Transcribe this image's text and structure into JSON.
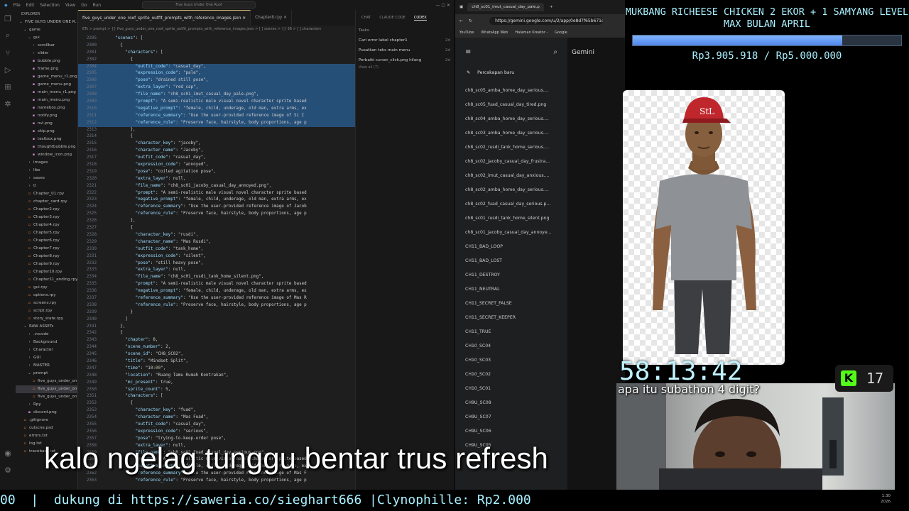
{
  "vscode": {
    "title_menu": [
      "File",
      "Edit",
      "Selection",
      "View",
      "Go",
      "Run"
    ],
    "search": "Five Guys Under One Roof",
    "explorer_title": "EXPLORER",
    "tree": [
      {
        "label": "FIVE GUYS UNDER ONE R...",
        "icon": "chevron-down",
        "indent": 0
      },
      {
        "label": "game",
        "icon": "chevron-down",
        "indent": 1
      },
      {
        "label": "gui",
        "icon": "chevron-down",
        "indent": 2
      },
      {
        "label": "scrollbar",
        "icon": "chevron-right",
        "indent": 3
      },
      {
        "label": "slider",
        "icon": "chevron-right",
        "indent": 3
      },
      {
        "label": "bubble.png",
        "icon": "image",
        "indent": 3
      },
      {
        "label": "frame.png",
        "icon": "image",
        "indent": 3
      },
      {
        "label": "game_menu_r1.png",
        "icon": "image",
        "indent": 3
      },
      {
        "label": "game_menu.png",
        "icon": "image",
        "indent": 3
      },
      {
        "label": "main_menu_r1.png",
        "icon": "image",
        "indent": 3
      },
      {
        "label": "main_menu.png",
        "icon": "image",
        "indent": 3
      },
      {
        "label": "namebox.png",
        "icon": "image",
        "indent": 3
      },
      {
        "label": "notify.png",
        "icon": "image",
        "indent": 3
      },
      {
        "label": "nvl.png",
        "icon": "image",
        "indent": 3
      },
      {
        "label": "skip.png",
        "icon": "image",
        "indent": 3
      },
      {
        "label": "textbox.png",
        "icon": "image",
        "indent": 3
      },
      {
        "label": "thoughtbubble.png",
        "icon": "image",
        "indent": 3
      },
      {
        "label": "window_icon.png",
        "icon": "image",
        "indent": 3
      },
      {
        "label": "images",
        "icon": "chevron-right",
        "indent": 2
      },
      {
        "label": "libs",
        "icon": "chevron-right",
        "indent": 2
      },
      {
        "label": "saves",
        "icon": "chevron-right",
        "indent": 2
      },
      {
        "label": "tl",
        "icon": "chevron-right",
        "indent": 2
      },
      {
        "label": "Chapter_01.rpy",
        "icon": "file",
        "indent": 2
      },
      {
        "label": "chapter_card.rpy",
        "icon": "file",
        "indent": 2
      },
      {
        "label": "Chapter2.rpy",
        "icon": "file",
        "indent": 2
      },
      {
        "label": "Chapter3.rpy",
        "icon": "file",
        "indent": 2
      },
      {
        "label": "Chapter4.rpy",
        "icon": "file",
        "indent": 2
      },
      {
        "label": "Chapter5.rpy",
        "icon": "file",
        "indent": 2
      },
      {
        "label": "Chapter6.rpy",
        "icon": "file",
        "indent": 2
      },
      {
        "label": "Chapter7.rpy",
        "icon": "file",
        "indent": 2
      },
      {
        "label": "Chapter8.rpy",
        "icon": "file",
        "indent": 2
      },
      {
        "label": "Chapter9.rpy",
        "icon": "file",
        "indent": 2
      },
      {
        "label": "Chapter10.rpy",
        "icon": "file",
        "indent": 2
      },
      {
        "label": "Chapter11_ending.rpy",
        "icon": "file",
        "indent": 2
      },
      {
        "label": "gui.rpy",
        "icon": "file",
        "indent": 2
      },
      {
        "label": "options.rpy",
        "icon": "file",
        "indent": 2
      },
      {
        "label": "screens.rpy",
        "icon": "file",
        "indent": 2
      },
      {
        "label": "script.rpy",
        "icon": "file",
        "indent": 2
      },
      {
        "label": "story_state.rpy",
        "icon": "file",
        "indent": 2
      },
      {
        "label": "RAW ASSETs",
        "icon": "chevron-down",
        "indent": 1
      },
      {
        "label": ".vscode",
        "icon": "chevron-right",
        "indent": 2
      },
      {
        "label": "Background",
        "icon": "chevron-right",
        "indent": 2
      },
      {
        "label": "Character",
        "icon": "chevron-right",
        "indent": 2
      },
      {
        "label": "GUI",
        "icon": "chevron-right",
        "indent": 2
      },
      {
        "label": "MASTER",
        "icon": "chevron-right",
        "indent": 2
      },
      {
        "label": "prompt",
        "icon": "chevron-down",
        "indent": 2
      },
      {
        "label": "five_guys_under_on...",
        "icon": "file",
        "indent": 3
      },
      {
        "label": "five_guys_under_on...",
        "icon": "file",
        "indent": 3,
        "selected": true
      },
      {
        "label": "five_guys_under_on...",
        "icon": "file",
        "indent": 3
      },
      {
        "label": "Rpy",
        "icon": "chevron-right",
        "indent": 2
      },
      {
        "label": "discord.png",
        "icon": "image",
        "indent": 2
      },
      {
        "label": ".gitignore",
        "icon": "file",
        "indent": 1
      },
      {
        "label": "cutscne.psd",
        "icon": "file",
        "indent": 1
      },
      {
        "label": "errors.txt",
        "icon": "file",
        "indent": 1
      },
      {
        "label": "log.txt",
        "icon": "file",
        "indent": 1
      },
      {
        "label": "traceback.txt",
        "icon": "file",
        "indent": 1
      }
    ],
    "tabs": [
      {
        "label": "five_guys_under_one_roof_sprite_outfit_prompts_with_reference_images.json",
        "active": true
      },
      {
        "label": "Chapter8.rpy",
        "active": false
      }
    ],
    "breadcrumb": "ETs > prompt > {} five_guys_under_one_roof_sprite_outfit_prompts_with_reference_images.json > [ ] scenes > {} 38 > [ ] characters",
    "code_lines": [
      {
        "n": "2205",
        "t": "    \"scenes\": [",
        "hl": false
      },
      {
        "n": "2300",
        "t": "      {",
        "hl": false
      },
      {
        "n": "2301",
        "t": "        \"characters\": [",
        "hl": false
      },
      {
        "n": "2302",
        "t": "          {",
        "hl": false
      },
      {
        "n": "2304",
        "t": "            \"outfit_code\": \"casual_day\",",
        "hl": true
      },
      {
        "n": "2305",
        "t": "            \"expression_code\": \"pale\",",
        "hl": true
      },
      {
        "n": "2306",
        "t": "            \"pose\": \"drained still pose\",",
        "hl": true
      },
      {
        "n": "2307",
        "t": "            \"extra_layer\": \"red_cap\",",
        "hl": true
      },
      {
        "n": "2308",
        "t": "            \"file_name\": \"ch8_sc01_imut_casual_day_pale.png\",",
        "hl": true
      },
      {
        "n": "2309",
        "t": "            \"prompt\": \"A semi-realistic male visual novel character sprite based",
        "hl": true
      },
      {
        "n": "2310",
        "t": "            \"negative_prompt\": \"female, child, underage, old man, extra arms, ex",
        "hl": true
      },
      {
        "n": "2311",
        "t": "            \"reference_summary\": \"Use the user-provided reference image of Si I",
        "hl": true
      },
      {
        "n": "2312",
        "t": "            \"reference_rule\": \"Preserve face, hairstyle, body proportions, age p",
        "hl": true
      },
      {
        "n": "2313",
        "t": "          },",
        "hl": false
      },
      {
        "n": "2314",
        "t": "          {",
        "hl": false
      },
      {
        "n": "2315",
        "t": "            \"character_key\": \"jacoby\",",
        "hl": false
      },
      {
        "n": "2316",
        "t": "            \"character_name\": \"Jacoby\",",
        "hl": false
      },
      {
        "n": "2317",
        "t": "            \"outfit_code\": \"casual_day\",",
        "hl": false
      },
      {
        "n": "2318",
        "t": "            \"expression_code\": \"annoyed\",",
        "hl": false
      },
      {
        "n": "2319",
        "t": "            \"pose\": \"coiled agitation pose\",",
        "hl": false
      },
      {
        "n": "2320",
        "t": "            \"extra_layer\": null,",
        "hl": false
      },
      {
        "n": "2321",
        "t": "            \"file_name\": \"ch8_sc01_jacoby_casual_day_annoyed.png\",",
        "hl": false
      },
      {
        "n": "2322",
        "t": "            \"prompt\": \"A semi-realistic male visual novel character sprite based",
        "hl": false
      },
      {
        "n": "2323",
        "t": "            \"negative_prompt\": \"female, child, underage, old man, extra arms, ex",
        "hl": false
      },
      {
        "n": "2324",
        "t": "            \"reference_summary\": \"Use the user-provided reference image of Jacob",
        "hl": false
      },
      {
        "n": "2325",
        "t": "            \"reference_rule\": \"Preserve face, hairstyle, body proportions, age p",
        "hl": false
      },
      {
        "n": "2326",
        "t": "          },",
        "hl": false
      },
      {
        "n": "2327",
        "t": "          {",
        "hl": false
      },
      {
        "n": "2328",
        "t": "            \"character_key\": \"rusdi\",",
        "hl": false
      },
      {
        "n": "2329",
        "t": "            \"character_name\": \"Mas Rusdi\",",
        "hl": false
      },
      {
        "n": "2330",
        "t": "            \"outfit_code\": \"tank_home\",",
        "hl": false
      },
      {
        "n": "2331",
        "t": "            \"expression_code\": \"silent\",",
        "hl": false
      },
      {
        "n": "2332",
        "t": "            \"pose\": \"still heavy pose\",",
        "hl": false
      },
      {
        "n": "2333",
        "t": "            \"extra_layer\": null,",
        "hl": false
      },
      {
        "n": "2334",
        "t": "            \"file_name\": \"ch8_sc01_rusdi_tank_home_silent.png\",",
        "hl": false
      },
      {
        "n": "2335",
        "t": "            \"prompt\": \"A semi-realistic male visual novel character sprite based",
        "hl": false
      },
      {
        "n": "2336",
        "t": "            \"negative_prompt\": \"female, child, underage, old man, extra arms, ex",
        "hl": false
      },
      {
        "n": "2337",
        "t": "            \"reference_summary\": \"Use the user-provided reference image of Mas R",
        "hl": false
      },
      {
        "n": "2338",
        "t": "            \"reference_rule\": \"Preserve face, hairstyle, body proportions, age p",
        "hl": false
      },
      {
        "n": "2339",
        "t": "          }",
        "hl": false
      },
      {
        "n": "2340",
        "t": "        ]",
        "hl": false
      },
      {
        "n": "2341",
        "t": "      },",
        "hl": false
      },
      {
        "n": "2342",
        "t": "      {",
        "hl": false
      },
      {
        "n": "2343",
        "t": "        \"chapter\": 8,",
        "hl": false
      },
      {
        "n": "2344",
        "t": "        \"scene_number\": 2,",
        "hl": false
      },
      {
        "n": "2345",
        "t": "        \"scene_id\": \"CH8_SC02\",",
        "hl": false
      },
      {
        "n": "2346",
        "t": "        \"title\": \"Mindset Split\",",
        "hl": false
      },
      {
        "n": "2347",
        "t": "        \"time\": \"10:00\",",
        "hl": false
      },
      {
        "n": "2348",
        "t": "        \"location\": \"Ruang Tamu Rumah Kontrakan\",",
        "hl": false
      },
      {
        "n": "2349",
        "t": "        \"mc_present\": true,",
        "hl": false
      },
      {
        "n": "2350",
        "t": "        \"sprite_count\": 5,",
        "hl": false
      },
      {
        "n": "2351",
        "t": "        \"characters\": [",
        "hl": false
      },
      {
        "n": "2352",
        "t": "          {",
        "hl": false
      },
      {
        "n": "2353",
        "t": "            \"character_key\": \"fuad\",",
        "hl": false
      },
      {
        "n": "2354",
        "t": "            \"character_name\": \"Mas Fuad\",",
        "hl": false
      },
      {
        "n": "2355",
        "t": "            \"outfit_code\": \"casual_day\",",
        "hl": false
      },
      {
        "n": "2356",
        "t": "            \"expression_code\": \"serious\",",
        "hl": false
      },
      {
        "n": "2357",
        "t": "            \"pose\": \"trying-to-keep-order pose\",",
        "hl": false
      },
      {
        "n": "2358",
        "t": "            \"extra_layer\": null,",
        "hl": false
      },
      {
        "n": "2359",
        "t": "            \"file_name\": \"ch8_sc02_fuad_casual_day_serious.png\",",
        "hl": false
      },
      {
        "n": "2360",
        "t": "            \"prompt\": \"A semi-realistic male visual novel character sprite based",
        "hl": false
      },
      {
        "n": "2361",
        "t": "            \"negative_prompt\": \"female, child, underage, old man, extra arms, ex",
        "hl": false
      },
      {
        "n": "2362",
        "t": "            \"reference_summary\": \"Use the user-provided reference image of Mas F",
        "hl": false
      },
      {
        "n": "2363",
        "t": "            \"reference_rule\": \"Preserve face, hairstyle, body proportions, age p",
        "hl": false
      }
    ],
    "side_tabs": [
      "CHAT",
      "CLAUDE CODE",
      "CODEX"
    ],
    "side_active": "CODEX",
    "tasks_header": "Tasks",
    "tasks": [
      {
        "label": "Cari error label chapter1",
        "age": "2d"
      },
      {
        "label": "Pusatkan teks main menu",
        "age": "2d"
      },
      {
        "label": "Perbaiki cursor_click.png hilang",
        "age": "2d"
      }
    ],
    "view_all": "View all (7)"
  },
  "browser": {
    "tab_label": "ch8_sc01_imut_casual_day_pale.p",
    "url": "https://gemini.google.com/u/2/app/0e8d7f65b671db6f?utm",
    "bookmarks": [
      "YouTube",
      "WhatsApp Web",
      "Halaman Kreator -",
      "Google"
    ],
    "brand": "Gemini",
    "new_chat": "Percakapan baru",
    "history": [
      "ch8_sc05_amba_home_day_serious....",
      "ch8_sc05_fuad_casual_day_tired.png",
      "ch8_sc04_amba_home_day_serious....",
      "ch8_sc03_amba_home_day_serious....",
      "ch8_sc02_rusdi_tank_home_serious....",
      "ch8_sc02_jacoby_casual_day_frustra...",
      "ch8_sc02_imut_casual_day_anxious....",
      "ch8_sc02_amba_home_day_serious....",
      "ch8_sc02_fuad_casual_day_serious.p...",
      "ch8_sc01_rusdi_tank_home_silent.png",
      "ch8_sc01_jacoby_casual_day_annoye...",
      "CH11_BAD_LOOP",
      "CH11_BAD_LOST",
      "CH11_DESTROY",
      "CH11_NEUTRAL",
      "CH11_SECRET_FALSE",
      "CH11_SECRET_KEEPER",
      "CH11_TRUE",
      "CH10_SC04",
      "CH10_SC03",
      "CH10_SC02",
      "CH10_SC01",
      "CH9U_SC08",
      "CH9U_SC07",
      "CH9U_SC06",
      "CH9U_SC05"
    ]
  },
  "overlay": {
    "goal_title": "MUKBANG RICHEESE CHICKEN 2 EKOR + 1 SAMYANG LEVEL MAX BULAN APRIL",
    "goal_progress": 0.78,
    "goal_amount": "Rp3.905.918 / Rp5.000.000",
    "timer": "58:13:42",
    "kick_count": "17",
    "question": "apa itu subathon 4 digit?",
    "caption": "kalo ngelag tunggu bentar trus refresh",
    "ticker": "00  |  dukung di https://saweria.co/sieghart666 |Clynophille: Rp2.000",
    "clock": "1:30",
    "date": "2026"
  }
}
